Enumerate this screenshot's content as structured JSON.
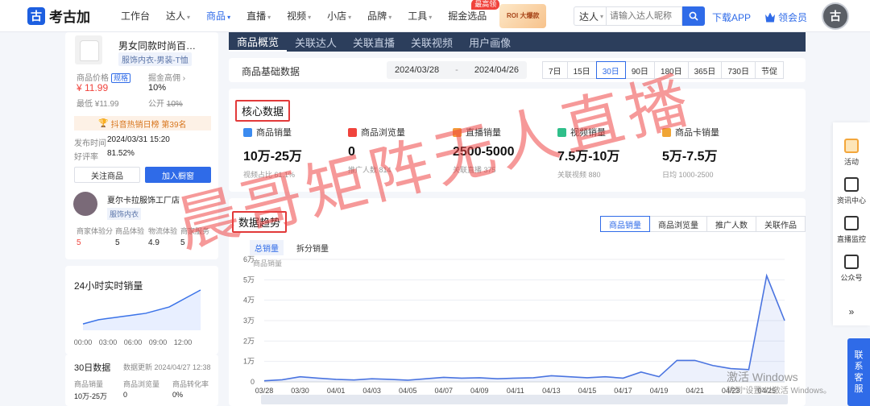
{
  "topbar": {
    "logo_text": "考古加",
    "nav": [
      {
        "label": "工作台",
        "caret": false,
        "active": false
      },
      {
        "label": "达人",
        "caret": true,
        "active": false
      },
      {
        "label": "商品",
        "caret": true,
        "active": true
      },
      {
        "label": "直播",
        "caret": true,
        "active": false
      },
      {
        "label": "视频",
        "caret": true,
        "active": false
      },
      {
        "label": "小店",
        "caret": true,
        "active": false
      },
      {
        "label": "品牌",
        "caret": true,
        "active": false
      },
      {
        "label": "工具",
        "caret": true,
        "active": false
      },
      {
        "label": "掘金选品",
        "caret": false,
        "active": false
      }
    ],
    "hot_badge": "最高领",
    "promo_line1": "ROI 大爆款",
    "search_type": "达人",
    "search_placeholder": "请输入达人昵称",
    "download": "下载APP",
    "vip": "领会员"
  },
  "product": {
    "name": "男女同款时尚百…",
    "category": "服饰内衣-男装-T恤",
    "price_label": "商品价格",
    "price_tag": "规格",
    "price": "¥ 11.99",
    "low_label": "最低 ¥11.99",
    "commission_label": "掘金高佣",
    "commission_val": "10%",
    "public_label": "公开",
    "public_val": "10%",
    "rank_text": "抖音热销日榜 第39名",
    "publish_label": "发布时间",
    "publish_val": "2024/03/31 15:20",
    "rating_label": "好评率",
    "rating_val": "81.52%",
    "follow_btn": "关注商品",
    "add_btn": "加入橱窗"
  },
  "shop": {
    "name": "夏尔卡拉服饰工厂店",
    "tag": "服饰内衣",
    "scores_labels": [
      "商家体验分",
      "商品体验",
      "物流体验",
      "商家服务"
    ],
    "scores_vals": [
      "5",
      "5",
      "4.9",
      "5"
    ]
  },
  "realtime": {
    "title": "24小时实时销量",
    "xticks": [
      "00:00",
      "03:00",
      "06:00",
      "09:00",
      "12:00"
    ],
    "values": [
      3,
      4,
      5,
      5.5,
      6,
      6.5,
      7,
      7.5,
      8,
      9,
      10,
      11,
      13,
      15,
      17,
      19
    ]
  },
  "d30": {
    "title": "30日数据",
    "updated": "数据更新 2024/04/27 12:38",
    "labels": [
      "商品销量",
      "商品浏览量",
      "商品转化率"
    ],
    "vals": [
      "10万-25万",
      "0",
      "0%"
    ]
  },
  "tabs": [
    "商品概览",
    "关联达人",
    "关联直播",
    "关联视频",
    "用户画像"
  ],
  "base": {
    "title": "商品基础数据",
    "date_from": "2024/03/28",
    "date_sep": "-",
    "date_to": "2024/04/26",
    "ranges": [
      "7日",
      "15日",
      "30日",
      "90日",
      "180日",
      "365日",
      "730日",
      "节促"
    ],
    "active_range": 2
  },
  "core": {
    "title": "核心数据",
    "metrics": [
      {
        "label": "商品销量",
        "value": "10万-25万",
        "sub": "视频占比 61.1%",
        "color": "#3b8bf0",
        "icon": "chart-icon"
      },
      {
        "label": "商品浏览量",
        "value": "0",
        "sub": "推广人数 814",
        "color": "#f0433c",
        "icon": "eye-icon"
      },
      {
        "label": "直播销量",
        "value": "2500-5000",
        "sub": "关联直播 375",
        "color": "#f39a3b",
        "icon": "live-icon"
      },
      {
        "label": "视频销量",
        "value": "7.5万-10万",
        "sub": "关联视频 880",
        "color": "#2fbf8a",
        "icon": "video-icon"
      },
      {
        "label": "商品卡销量",
        "value": "5万-7.5万",
        "sub": "日均 1000-2500",
        "color": "#f0a535",
        "icon": "card-icon"
      }
    ]
  },
  "trend": {
    "title": "数据趋势",
    "tabs": [
      "商品销量",
      "商品浏览量",
      "推广人数",
      "关联作品"
    ],
    "sub_active": "总销量",
    "sub_other": "拆分销量",
    "legend": "商品销量"
  },
  "chart_data": {
    "type": "area",
    "title": "",
    "ylabel": "商品销量",
    "yticks": [
      "0",
      "1万",
      "2万",
      "3万",
      "4万",
      "5万",
      "6万"
    ],
    "ylim": [
      0,
      60000
    ],
    "x": [
      "03/28",
      "03/29",
      "03/30",
      "03/31",
      "04/01",
      "04/02",
      "04/03",
      "04/04",
      "04/05",
      "04/06",
      "04/07",
      "04/08",
      "04/09",
      "04/10",
      "04/11",
      "04/12",
      "04/13",
      "04/14",
      "04/15",
      "04/16",
      "04/17",
      "04/18",
      "04/19",
      "04/20",
      "04/21",
      "04/22",
      "04/23",
      "04/24",
      "04/25",
      "04/26"
    ],
    "xtick_labels": [
      "03/28",
      "03/30",
      "04/01",
      "04/03",
      "04/05",
      "04/07",
      "04/09",
      "04/11",
      "04/13",
      "04/15",
      "04/17",
      "04/19",
      "04/21",
      "04/23",
      "04/25"
    ],
    "series": [
      {
        "name": "商品销量",
        "values": [
          500,
          1000,
          2500,
          1800,
          1200,
          900,
          1500,
          1200,
          800,
          1500,
          2200,
          1800,
          2000,
          1500,
          1800,
          2000,
          3000,
          2500,
          2000,
          2500,
          1800,
          4800,
          2500,
          10500,
          10500,
          8000,
          6500,
          6000,
          52000,
          30000
        ]
      }
    ]
  },
  "rbar": {
    "items": [
      {
        "label": "活动",
        "icon": "gift-icon"
      },
      {
        "label": "资讯中心",
        "icon": "news-icon"
      },
      {
        "label": "直播监控",
        "icon": "monitor-icon"
      },
      {
        "label": "公众号",
        "icon": "wechat-icon"
      }
    ],
    "more": "»",
    "service": "联系客服"
  },
  "watermark": "晨哥矩阵无人直播",
  "windows": {
    "line1": "激活 Windows",
    "line2": "转到“设置”以激活 Windows。"
  }
}
